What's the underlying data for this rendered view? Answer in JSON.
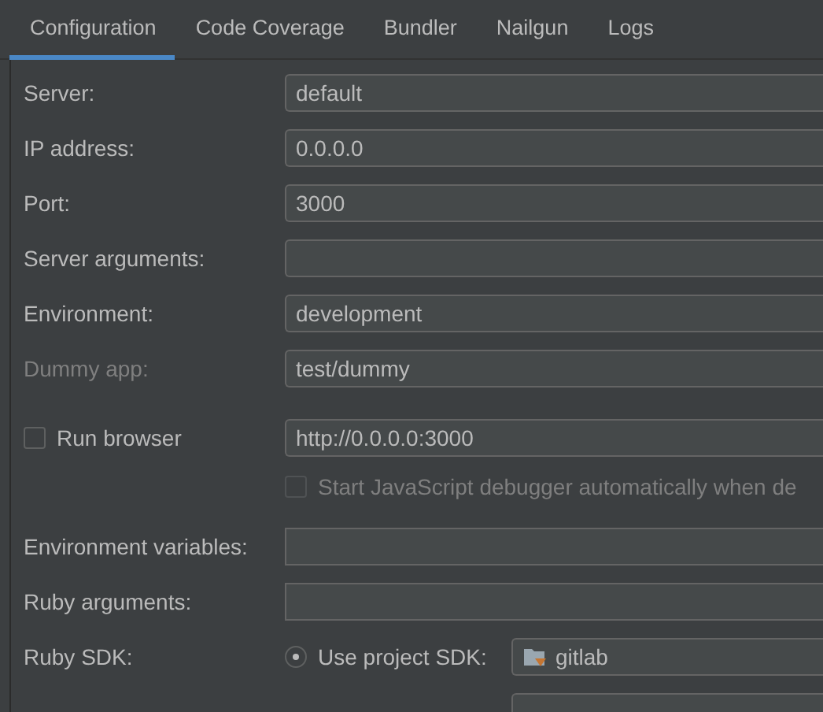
{
  "tabs": [
    {
      "label": "Configuration",
      "selected": true
    },
    {
      "label": "Code Coverage",
      "selected": false
    },
    {
      "label": "Bundler",
      "selected": false
    },
    {
      "label": "Nailgun",
      "selected": false
    },
    {
      "label": "Logs",
      "selected": false
    }
  ],
  "fields": [
    {
      "label": "Server:",
      "value": "default",
      "disabled": false
    },
    {
      "label": "IP address:",
      "value": "0.0.0.0",
      "disabled": false
    },
    {
      "label": "Port:",
      "value": "3000",
      "disabled": false
    },
    {
      "label": "Server arguments:",
      "disabled": false
    },
    {
      "label": "Environment:",
      "value": "development",
      "disabled": false
    },
    {
      "label": "Dummy app:",
      "value": "test/dummy",
      "disabled": true
    }
  ],
  "browser": {
    "label": "Run browser",
    "checked": false,
    "url": "http://0.0.0.0:3000"
  },
  "debugger": {
    "label": "Start JavaScript debugger automatically when de",
    "checked": false,
    "disabled": true
  },
  "extra_fields": [
    {
      "label": "Environment variables:"
    },
    {
      "label": "Ruby arguments:"
    }
  ],
  "ruby_sdk": {
    "label": "Ruby SDK:",
    "option": {
      "label": "Use project SDK:",
      "selected": true
    },
    "sdk": "gitlab"
  }
}
